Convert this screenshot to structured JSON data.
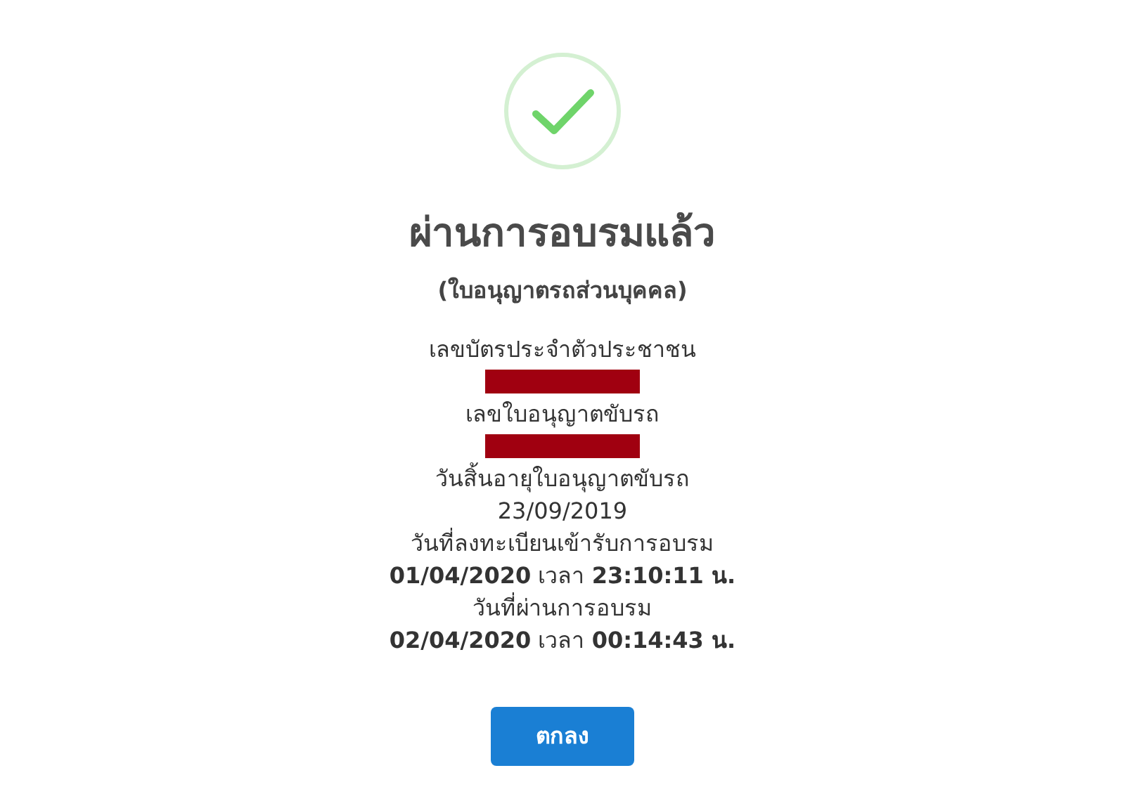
{
  "title": "ผ่านการอบรมแล้ว",
  "subtitle": "(ใบอนุญาตรถส่วนบุคคล)",
  "lines": [
    {
      "kind": "label",
      "text": "เลขบัตรประจำตัวประชาชน"
    },
    {
      "kind": "redacted"
    },
    {
      "kind": "label",
      "text": "เลขใบอนุญาตขับรถ"
    },
    {
      "kind": "redacted"
    },
    {
      "kind": "label",
      "text": "วันสิ้นอายุใบอนุญาตขับรถ"
    },
    {
      "kind": "value",
      "text": "23/09/2019"
    },
    {
      "kind": "label",
      "text": "วันที่ลงทะเบียนเข้ารับการอบรม"
    },
    {
      "kind": "value",
      "text": "**01/04/2020** เวลา **23:10:11 น.**"
    },
    {
      "kind": "label",
      "text": "วันที่ผ่านการอบรม"
    },
    {
      "kind": "value",
      "text": "**02/04/2020** เวลา **00:14:43 น.**"
    }
  ],
  "button": "ตกลง"
}
